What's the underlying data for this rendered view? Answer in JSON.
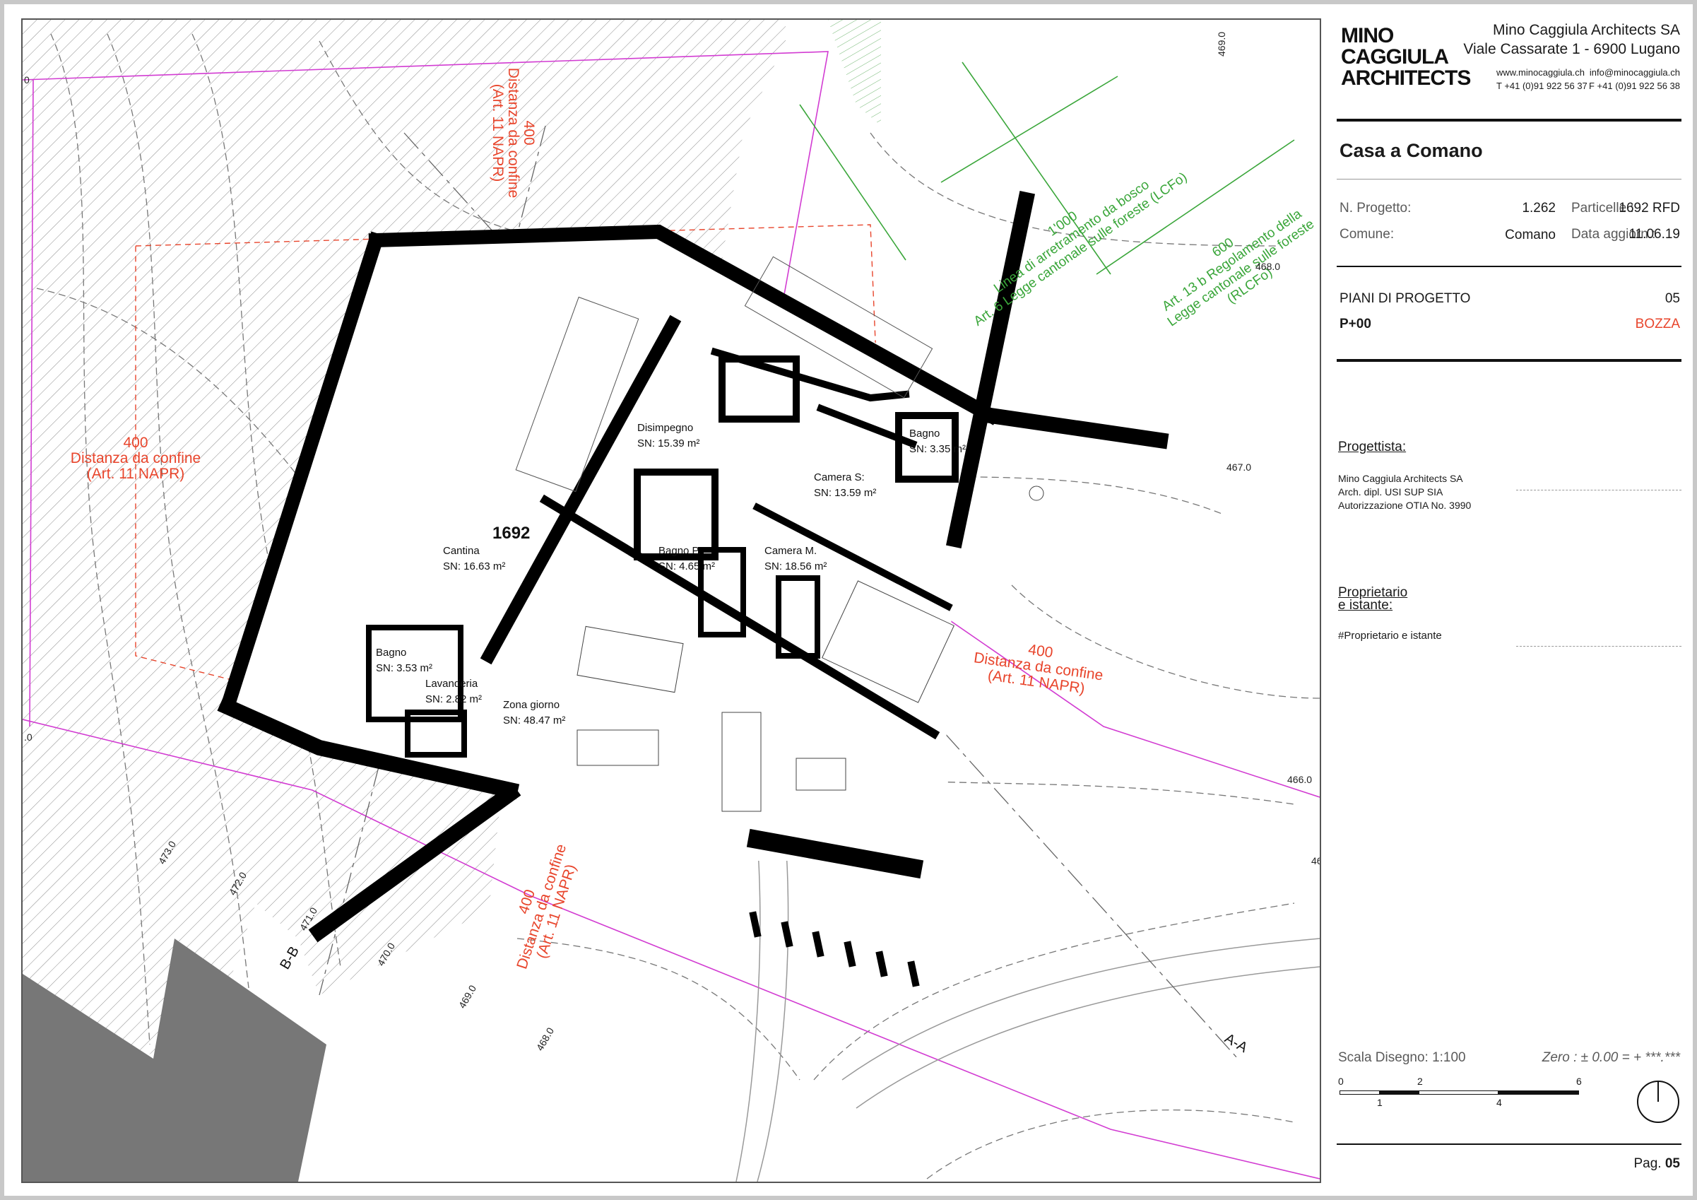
{
  "plan": {
    "parcel": "1692",
    "rooms": [
      {
        "name": "Disimpegno",
        "area": "SN: 15.39 m²"
      },
      {
        "name": "Camera S:",
        "area": "SN: 13.59 m²"
      },
      {
        "name": "Bagno",
        "area": "SN: 3.35 m²"
      },
      {
        "name": "Cantina",
        "area": "SN: 16.63 m²"
      },
      {
        "name": "Bagno P.",
        "area": "SN: 4.65 m²"
      },
      {
        "name": "Camera M.",
        "area": "SN: 18.56 m²"
      },
      {
        "name": "Bagno",
        "area": "SN: 3.53 m²"
      },
      {
        "name": "Lavanderia",
        "area": "SN: 2.82 m²"
      },
      {
        "name": "Zona giorno",
        "area": "SN: 48.47 m²"
      }
    ],
    "setbacks": [
      {
        "value": "400",
        "line1": "Distanza da confine",
        "line2": "(Art. 11 NAPR)"
      },
      {
        "value": "400",
        "line1": "Distanza da confine",
        "line2": "(Art. 11 NAPR)"
      },
      {
        "value": "400",
        "line1": "Distanza da confine",
        "line2": "(Art. 11 NAPR)"
      },
      {
        "value": "400",
        "line1": "Distanza da confine",
        "line2": "(Art. 11 NAPR)"
      }
    ],
    "forest": [
      {
        "value": "1'000",
        "line1": "Linea di arretramento da bosco",
        "line2": "Art. 6 Legge cantonale sulle foreste (LCFo)"
      },
      {
        "value": "600",
        "line1": "Art. 13 b Regolamento della",
        "line2": "Legge cantonale sulle foreste",
        "line3": "(RLCFo)"
      }
    ],
    "contours": [
      "469.0",
      "468.0",
      "467.0",
      "466.0",
      "473.0",
      "472.0",
      "471.0",
      "470.0",
      "469.0",
      "468.0",
      "46"
    ],
    "sections": [
      "B-B",
      "A-A"
    ],
    "edge_labels": [
      "0",
      ".0"
    ]
  },
  "panel": {
    "logo_lines": [
      "MINO",
      "CAGGIULA",
      "ARCHITECTS"
    ],
    "firm": "Mino Caggiula Architects SA",
    "address": "Viale Cassarate 1 - 6900 Lugano",
    "web": "www.minocaggiula.ch",
    "email": "info@minocaggiula.ch",
    "tel": "T +41 (0)91 922 56 37",
    "fax": "F +41 (0)91 922 56 38",
    "project_title": "Casa a Comano",
    "n_progetto_label": "N. Progetto:",
    "n_progetto": "1.262",
    "particelle_label": "Particelle :",
    "particelle": "1692 RFD",
    "comune_label": "Comune:",
    "comune": "Comano",
    "data_label": "Data aggiorn.:",
    "data": "11.06.19",
    "piani_label": "PIANI DI PROGETTO",
    "piani_num": "05",
    "floor": "P+00",
    "status": "BOZZA",
    "status_color": "#e8452c",
    "progettista_label": "Progettista:",
    "progettista_lines": [
      "Mino Caggiula Architects SA",
      "Arch. dipl. USI SUP SIA",
      "Autorizzazione OTIA No. 3990"
    ],
    "proprietario_label_1": "Proprietario",
    "proprietario_label_2": "e istante:",
    "proprietario_value": "#Proprietario e istante",
    "scale_label": "Scala Disegno: 1:100",
    "zero_label": "Zero : ± 0.00 = + ***.***",
    "scale_ticks_top": [
      "0",
      "2",
      "6"
    ],
    "scale_ticks_bottom": [
      "1",
      "4"
    ],
    "page_label": "Pag.",
    "page_num": "05"
  }
}
